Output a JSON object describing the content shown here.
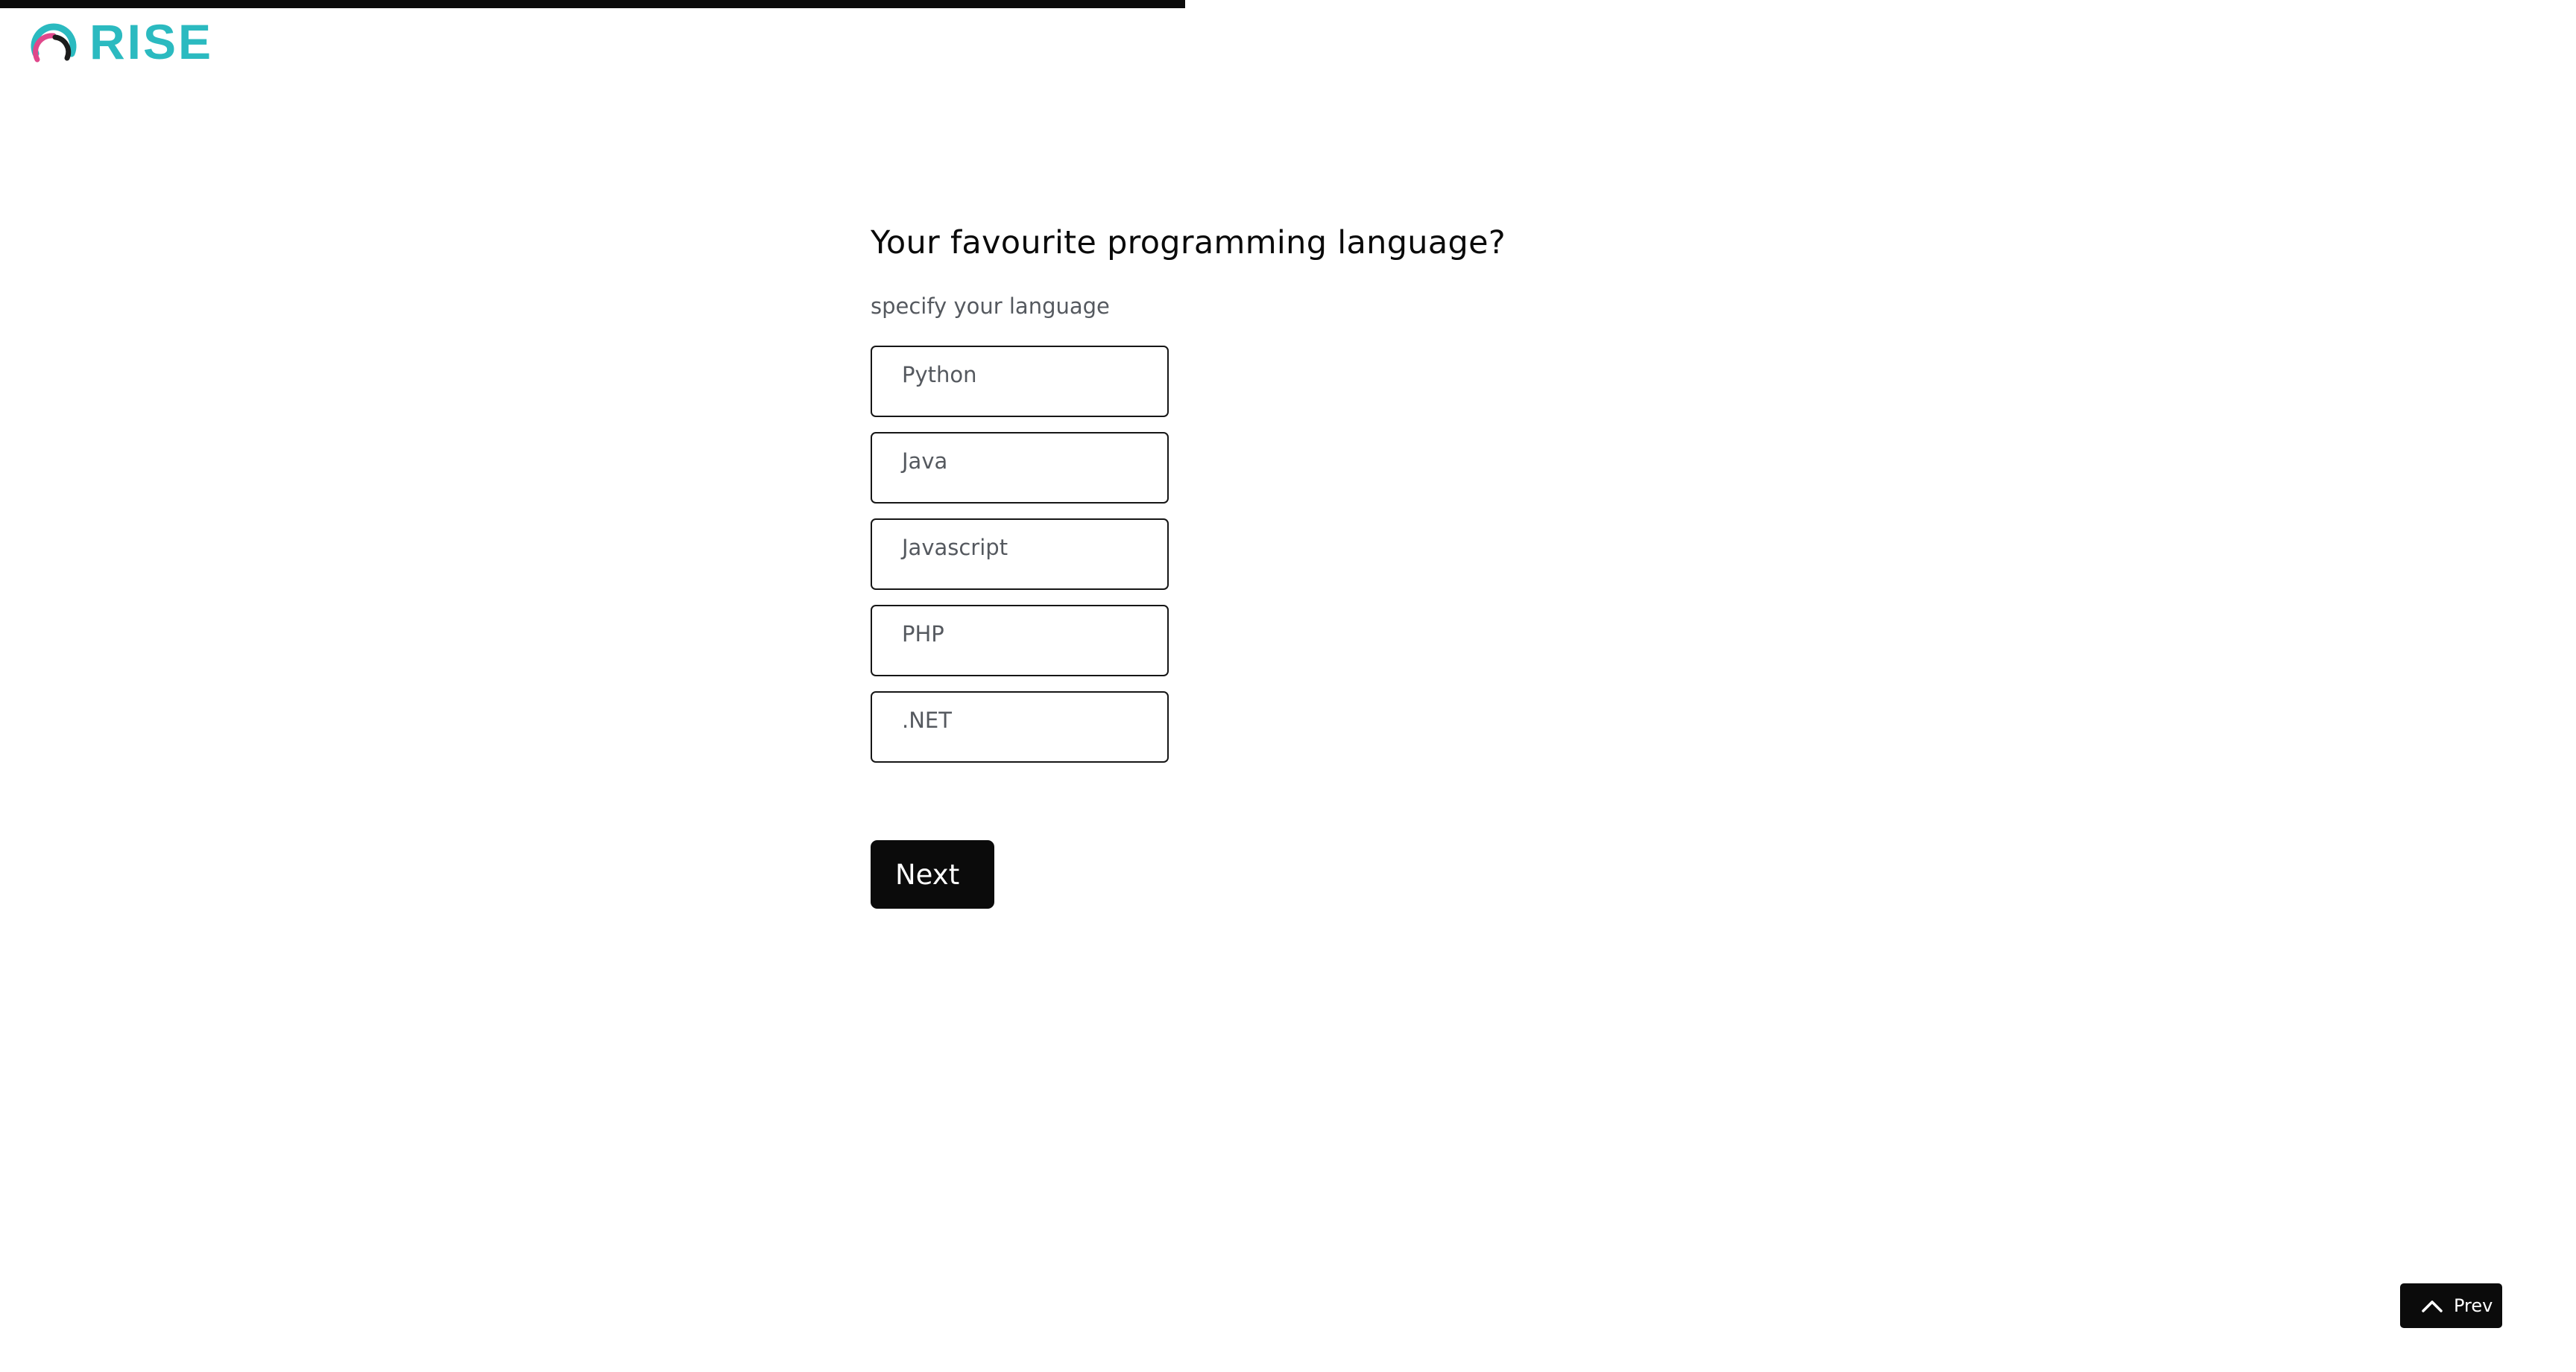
{
  "brand": {
    "name": "RISE",
    "color": "#2bbac0",
    "mark_colors": [
      "#2bbac0",
      "#e0488b",
      "#1c1c1c"
    ]
  },
  "progress": {
    "fraction": 0.46
  },
  "question": {
    "title": "Your favourite programming language?",
    "hint": "specify your language"
  },
  "options": [
    {
      "label": "Python"
    },
    {
      "label": "Java"
    },
    {
      "label": "Javascript"
    },
    {
      "label": "PHP"
    },
    {
      "label": ".NET"
    }
  ],
  "actions": {
    "next_label": "Next",
    "prev_label": "Prev",
    "prev_icon": "chevron-up-icon"
  }
}
